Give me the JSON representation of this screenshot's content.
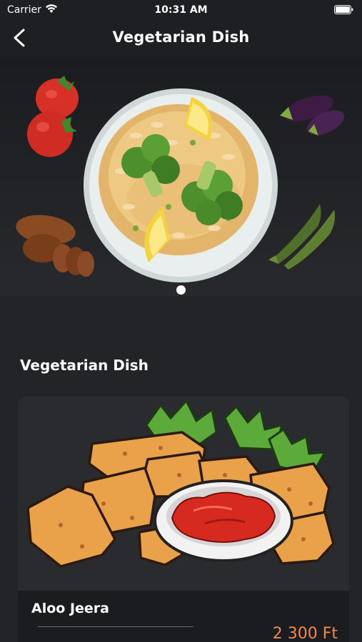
{
  "status_bar": {
    "carrier": "Carrier",
    "time": "10:31 AM"
  },
  "nav": {
    "title": "Vegetarian Dish",
    "back_icon": "chevron-left-icon"
  },
  "hero": {
    "slides_total": 1,
    "active_slide": 1
  },
  "section": {
    "title": "Vegetarian Dish"
  },
  "products": [
    {
      "name": "Aloo Jeera",
      "price": "2 300 Ft"
    }
  ],
  "colors": {
    "background": "#232427",
    "bar": "#1e1f22",
    "price": "#f08a4b"
  }
}
